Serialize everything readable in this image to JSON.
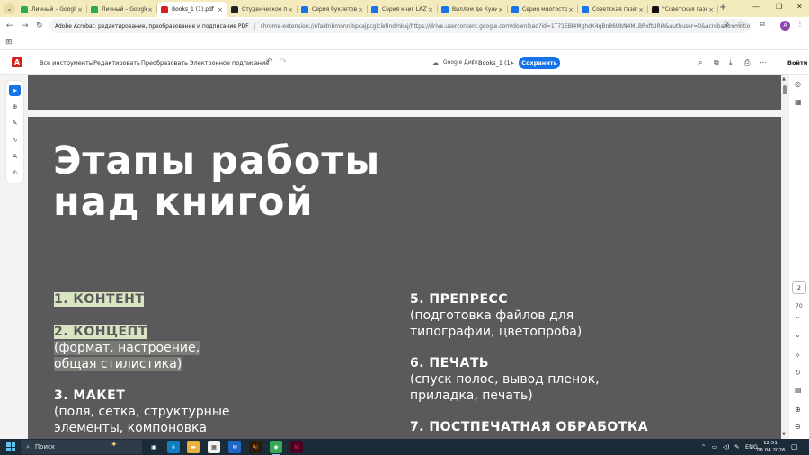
{
  "browser": {
    "tabs": [
      {
        "title": "Личный – Google",
        "icon_color": "#2da94f",
        "active": false
      },
      {
        "title": "Личный – Google",
        "icon_color": "#2da94f",
        "active": false
      },
      {
        "title": "Books_1 (1).pdf",
        "icon_color": "#d7201c",
        "active": true
      },
      {
        "title": "Студенческое пр",
        "icon_color": "#222222",
        "active": false
      },
      {
        "title": "Серия буклетов",
        "icon_color": "#1a73e8",
        "active": false
      },
      {
        "title": "Серия книг LAZY",
        "icon_color": "#1a73e8",
        "active": false
      },
      {
        "title": "Виллем де Кунин",
        "icon_color": "#1a73e8",
        "active": false
      },
      {
        "title": "Серия многостр",
        "icon_color": "#1a73e8",
        "active": false
      },
      {
        "title": "Советская газет",
        "icon_color": "#1a73e8",
        "active": false
      },
      {
        "title": "\"Советская газе",
        "icon_color": "#111111",
        "active": false
      }
    ],
    "tab_close_glyph": "×",
    "new_tab_glyph": "+",
    "site_chip": "Adobe Acrobat: редактирование, преобразование и подписание PDF",
    "url": "chrome-extension://efaidnbmnnnibpcajpcglclefindmkaj/https://drive.usercontent.google.com/download?id=1T71EBl4MghoK4qBn86UbN4MLBRxftURM&authuser=0&acrobatPromotio...",
    "profile_initial": "A"
  },
  "acrobat": {
    "menu": [
      "Все инструменты",
      "Редактировать",
      "Преобразовать",
      "Электронное подписание"
    ],
    "drive_label": "Google Диск",
    "crumb_separator": "/",
    "file_name": "Books_1 (1)",
    "save_label": "Сохранить",
    "login_label": "Войти",
    "current_page": "2",
    "zoom": "70"
  },
  "document": {
    "title_line1": "Этапы работы",
    "title_line2": "над книгой",
    "stages_left": [
      {
        "head": "1. КОНТЕНТ",
        "desc": []
      },
      {
        "head": "2. КОНЦЕПТ",
        "desc": [
          "(формат, настроение,",
          "общая стилистика)"
        ]
      },
      {
        "head": "3. МАКЕТ",
        "desc": [
          "(поля, сетка, структурные",
          "элементы, компоновка"
        ]
      }
    ],
    "stages_right": [
      {
        "head": "5. ПРЕПРЕСС",
        "desc": [
          "(подготовка файлов для",
          "типографии, цветопроба)"
        ]
      },
      {
        "head": "6. ПЕЧАТЬ",
        "desc": [
          "(спуск полос, вывод пленок,",
          "приладка, печать)"
        ]
      },
      {
        "head": "7. ПОСТПЕЧАТНАЯ ОБРАБОТКА",
        "desc": []
      }
    ]
  },
  "taskbar": {
    "search_placeholder": "Поиск",
    "lang": "ENG",
    "time": "12:51",
    "date": "06.04.2026"
  },
  "colors": {
    "tab_strip": "#f3ebbe",
    "accent_blue": "#1473e6",
    "acrobat_red": "#d7201c",
    "page_bg": "#5a5a5c",
    "highlight": "#d9e4c2",
    "taskbar": "#1c2b38"
  }
}
